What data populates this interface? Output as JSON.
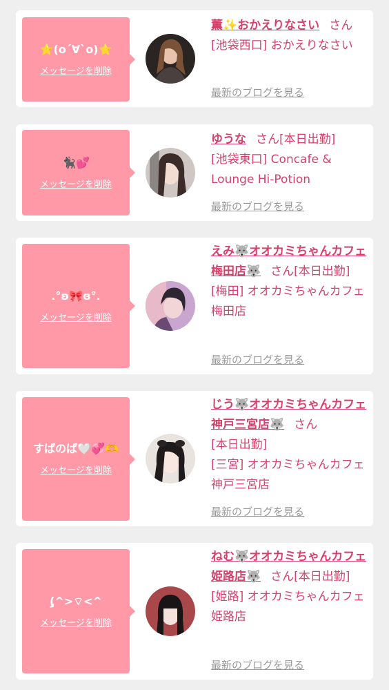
{
  "colors": {
    "page_bg": "#efefef",
    "card_bg": "#ffffff",
    "bubble_bg": "#ff99a8",
    "accent": "#d6416b",
    "muted_link": "#999999"
  },
  "messages": [
    {
      "message_text": "⭐(o´∀`o)⭐",
      "delete_label": "メッセージを削除",
      "name": "薫✨おかえりなさい",
      "name_suffix": "さん",
      "status": "",
      "shop": "[池袋西口] おかえりなさい",
      "blog_label": "最新のブログを見る"
    },
    {
      "message_text": "🐈‍⬛💕",
      "delete_label": "メッセージを削除",
      "name": "ゆうな",
      "name_suffix": "さん",
      "status": "[本日出勤]",
      "shop": "[池袋東口] Concafe & Lounge Hi-Potion",
      "blog_label": "最新のブログを見る"
    },
    {
      "message_text": ".°ʚ🎀ɞ°.",
      "delete_label": "メッセージを削除",
      "name": "えみ🐺オオカミちゃんカフェ梅田店🐺",
      "name_suffix": "さん",
      "status": "[本日出勤]",
      "shop": "[梅田] オオカミちゃんカフェ梅田店",
      "blog_label": "最新のブログを見る"
    },
    {
      "message_text": "すぱのぱ🤍💞🫶",
      "delete_label": "メッセージを削除",
      "name": "じう🐺オオカミちゃんカフェ神戸三宮店🐺",
      "name_suffix": "さん",
      "status": "[本日出勤]",
      "shop": "[三宮] オオカミちゃんカフェ神戸三宮店",
      "blog_label": "最新のブログを見る"
    },
    {
      "message_text": "(̨̡^>⌔<^",
      "delete_label": "メッセージを削除",
      "name": "ねむ🐺オオカミちゃんカフェ姫路店🐺",
      "name_suffix": "さん",
      "status": "[本日出勤]",
      "shop": "[姫路] オオカミちゃんカフェ姫路店",
      "blog_label": "最新のブログを見る"
    }
  ]
}
